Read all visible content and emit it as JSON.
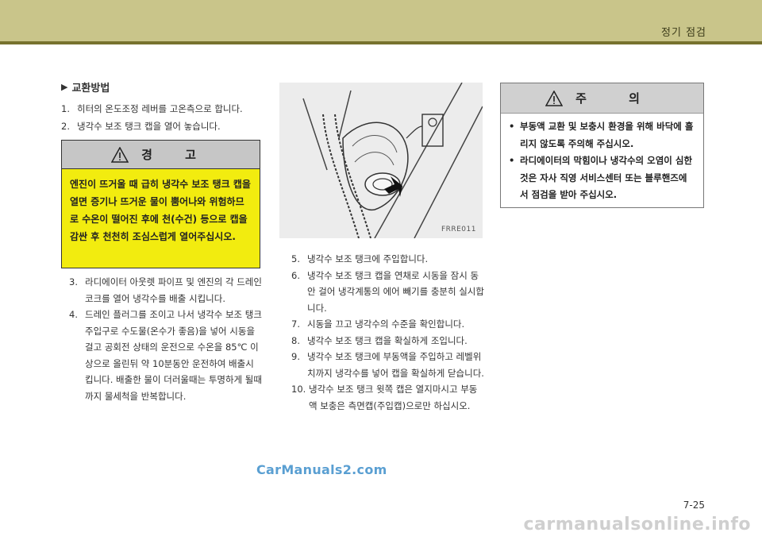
{
  "header": {
    "section_title": "정기 점검",
    "band_color": "#c9c58a",
    "line_color": "#77722e"
  },
  "replacement": {
    "heading": "교환방법",
    "steps_a": [
      {
        "num": "1.",
        "text": "히터의 온도조정 레버를 고온측으로 합니다."
      },
      {
        "num": "2.",
        "text": "냉각수 보조 탱크 캡을 열어 놓습니다."
      }
    ],
    "steps_b": [
      {
        "num": "3.",
        "text": "라디에이터 아웃렛 파이프 및 엔진의 각 드레인 코크를 열어 냉각수를 배출 시킵니다."
      },
      {
        "num": "4.",
        "text": "드레인 플러그를 조이고 나서 냉각수 보조 탱크 주입구로 수도물(온수가 좋음)을 넣어 시동을 걸고 공회전 상태의 운전으로 수온을 85℃ 이상으로 올린뒤 약 10분동안 운전하여 배출시킵니다. 배출한 물이 더러울때는 투명하게 될때까지 물세척을 반복합니다."
      }
    ]
  },
  "warning": {
    "title": "경 고",
    "text": "엔진이 뜨거울 때 급히 냉각수 보조 탱크 캡을 열면 증기나 뜨거운 물이 뿜어나와 위험하므로 수온이 떨어진 후에 천(수건) 등으로 캡을 감싼 후 천천히 조심스럽게 열어주십시오.",
    "bg_color": "#f2ec0f"
  },
  "photo": {
    "code": "FRRE011"
  },
  "steps_c": [
    {
      "num": "5.",
      "text": "냉각수 보조 탱크에 주입합니다."
    },
    {
      "num": "6.",
      "text": "냉각수 보조 탱크 캡을 연채로 시동을 잠시 동안 걸어 냉각계통의 에어 빼기를 충분히 실시합니다."
    },
    {
      "num": "7.",
      "text": "시동을 끄고 냉각수의 수준을 확인합니다."
    },
    {
      "num": "8.",
      "text": "냉각수 보조 탱크 캡을 확실하게 조입니다."
    },
    {
      "num": "9.",
      "text": "냉각수 보조 탱크에 부동액을 주입하고 레벨위치까지 냉각수를 넣어 캡을 확실하게 닫습니다."
    },
    {
      "num": "10.",
      "text": "냉각수 보조 탱크 윗쪽 캡은 열지마시고 부동액 보충은 측면캡(주입캡)으로만 하십시오."
    }
  ],
  "caution": {
    "title": "주 의",
    "items": [
      "부동액 교환 및 보충시 환경을 위해 바닥에 흘리지 않도록 주의해 주십시오.",
      "라디에이터의 막힘이나 냉각수의 오염이 심한 것은 자사 직영 서비스센터 또는 블루핸즈에서 점검을 받아 주십시오."
    ]
  },
  "footer": {
    "page": "7-25",
    "watermark1": "CarManuals2.com",
    "watermark2": "carmanualsonline.info"
  }
}
